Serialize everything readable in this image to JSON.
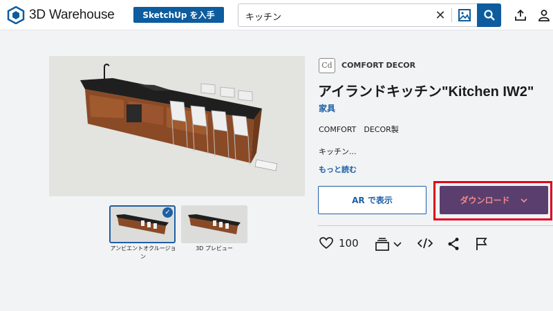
{
  "header": {
    "logo_text": "3D Warehouse",
    "sketchup_button": "SketchUp を入手",
    "search_value": "キッチン",
    "search_clear": "✕"
  },
  "gallery": {
    "thumbnails": [
      {
        "label": "アンビエントオクルージョン",
        "selected": true
      },
      {
        "label": "3D プレビュー",
        "selected": false
      }
    ]
  },
  "model": {
    "brand": "COMFORT DECOR",
    "brand_logo": "Cd",
    "title": "アイランドキッチン\"Kitchen IW2\"",
    "category": "家具",
    "description_line1": "COMFORT　DECOR製",
    "description_line2": "キッチン...",
    "read_more": "もっと読む",
    "ar_button": "AR で表示",
    "download_button": "ダウンロード",
    "like_count": "100"
  },
  "colors": {
    "accent": "#1c5fa5",
    "download_bg": "#5a3f6e",
    "download_text": "#f08a8a",
    "highlight": "#e0001b"
  },
  "icons": [
    "warehouse-logo-icon",
    "close-icon",
    "image-search-icon",
    "search-icon",
    "upload-icon",
    "user-icon",
    "heart-icon",
    "collection-icon",
    "chevron-down-icon",
    "embed-code-icon",
    "share-icon",
    "flag-icon",
    "check-icon"
  ]
}
